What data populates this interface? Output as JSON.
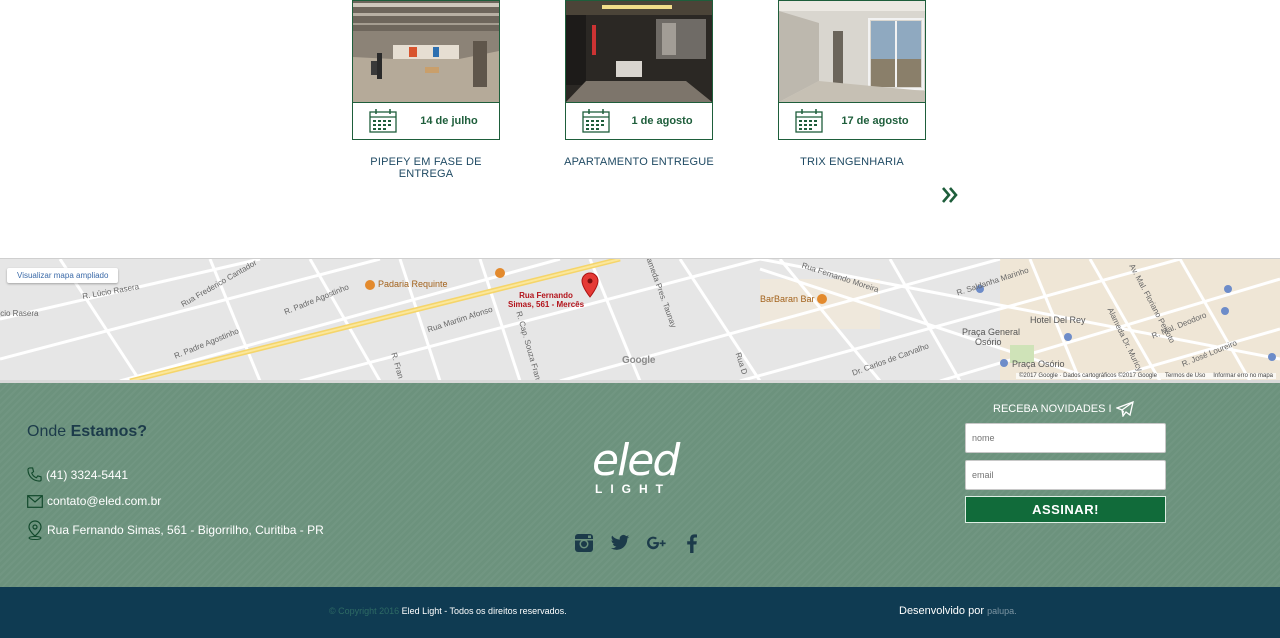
{
  "news": {
    "items": [
      {
        "date": "14 de julho",
        "title": "PIPEFY EM FASE DE ENTREGA"
      },
      {
        "date": "1 de agosto",
        "title": "APARTAMENTO ENTREGUE"
      },
      {
        "date": "17 de agosto",
        "title": "TRIX ENGENHARIA"
      }
    ],
    "more_icon": "double-chevron-right-icon"
  },
  "map": {
    "enlarge_label": "Visualizar mapa ampliado",
    "pin_label_line1": "Rua Fernando",
    "pin_label_line2": "Simas, 561 - Mercês",
    "labels": {
      "padaria": "Padaria Requinte",
      "barbaran": "BarBaran Bar",
      "hotel": "Hotel Del Rey",
      "praca_general_1": "Praça General",
      "praca_general_2": "Osório",
      "praca_osorio": "Praça Osório",
      "padre": "R. Padre Agostinho",
      "padre2": "R. Padre Agostinho",
      "martim": "Rua Martim Afonso",
      "saldanha": "R. Saldanha Marinho",
      "carlos": "Dr. Carlos de Carvalho",
      "deodoro": "R. Mal. Deodoro",
      "loureiro": "R. José Loureiro",
      "floriano": "Av. Mal. Floriano Peixoto",
      "lucio": "R. Lúcio Rasera",
      "cap": "R. Cap. Souza Franco",
      "federico": "Rua Frederico Cantador",
      "alameda": "Alameda Pres. Taunay",
      "fernando_moreira": "Rua Fernando Moreira",
      "alameda_muricy": "Alameda Dr. Muricy",
      "rua_d": "Rua D",
      "r_fran": "R. Fran",
      "rasera": "ício Rasera"
    },
    "google_logo": "Google",
    "footer": {
      "data": "©2017 Google · Dados cartográficos ©2017 Google",
      "terms": "Termos de Uso",
      "report": "Informar erro no mapa"
    },
    "colors": {
      "bg": "#e8e8e8",
      "road": "#ffffff",
      "major_road": "#f7d86b",
      "pin": "#e53935"
    }
  },
  "footer": {
    "where_prefix": "Onde ",
    "where_bold": "Estamos?",
    "phone": "(41) 3324-5441",
    "email": "contato@eled.com.br",
    "address": "Rua Fernando Simas, 561 - Bigorrilho, Curitiba - PR",
    "logo_word": "eled",
    "logo_sub": "LIGHT",
    "socials": [
      "instagram-icon",
      "twitter-icon",
      "google-plus-icon",
      "facebook-icon"
    ],
    "newsletter": {
      "title": "RECEBA NOVIDADES I",
      "name_placeholder": "nome",
      "email_placeholder": "email",
      "button": "ASSINAR!"
    },
    "colors": {
      "bg": "#6c927d",
      "title": "#1c3b4a",
      "button": "#116b3a"
    }
  },
  "bottom": {
    "copyright_dim": "© Copyright 2016",
    "copyright": " Eled Light - Todos os direitos reservados.",
    "dev_prefix": "Desenvolvido por ",
    "dev_brand": "palupa.",
    "colors": {
      "bg": "#0f3b52"
    }
  }
}
